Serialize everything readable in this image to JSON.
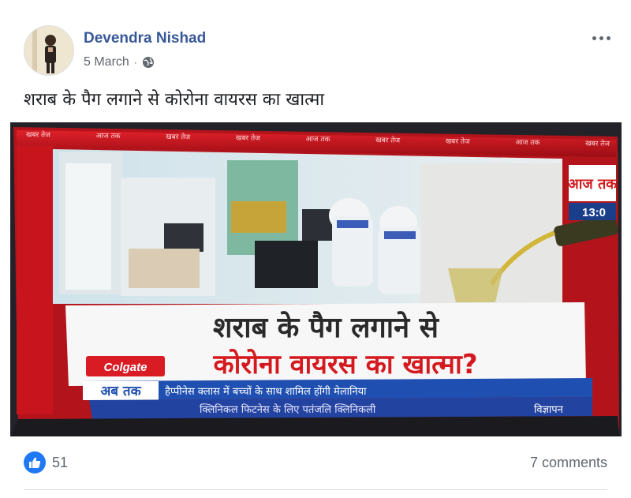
{
  "post": {
    "author": "Devendra Nishad",
    "date": "5 March",
    "separator": "·",
    "text": "शराब के पैग लगाने से कोरोना वायरस का खात्मा"
  },
  "photo": {
    "channel_logo": "आज तक",
    "clock": "13:0",
    "top_strip": [
      "खबर तेज",
      "आज तक",
      "खबर तेज",
      "खबर तेज",
      "आज तक",
      "खबर तेज",
      "खबर तेज",
      "आज तक",
      "खबर तेज"
    ],
    "headline_line1": "शराब के पैग लगाने से",
    "headline_line2": "कोरोना वायरस का खात्मा?",
    "sponsor": "Colgate",
    "ticker_label": "अब तक",
    "ticker_text": "हैप्पीनेस क्लास में बच्चों के साथ शामिल होंगी मेलानिया",
    "crawl_text": "क्लिनिकल फिटनेस के लिए पतंजलि क्लिनिकली",
    "ad_label": "विज्ञापन"
  },
  "footer": {
    "like_count": "51",
    "comments": "7 comments"
  },
  "icons": {
    "globe": "globe-icon",
    "more": "more-options-icon",
    "like": "like-icon"
  },
  "colors": {
    "author_link": "#385898",
    "like_blue": "#2078f4",
    "headline_red": "#d51a1f",
    "banner_red": "#c4121b"
  }
}
